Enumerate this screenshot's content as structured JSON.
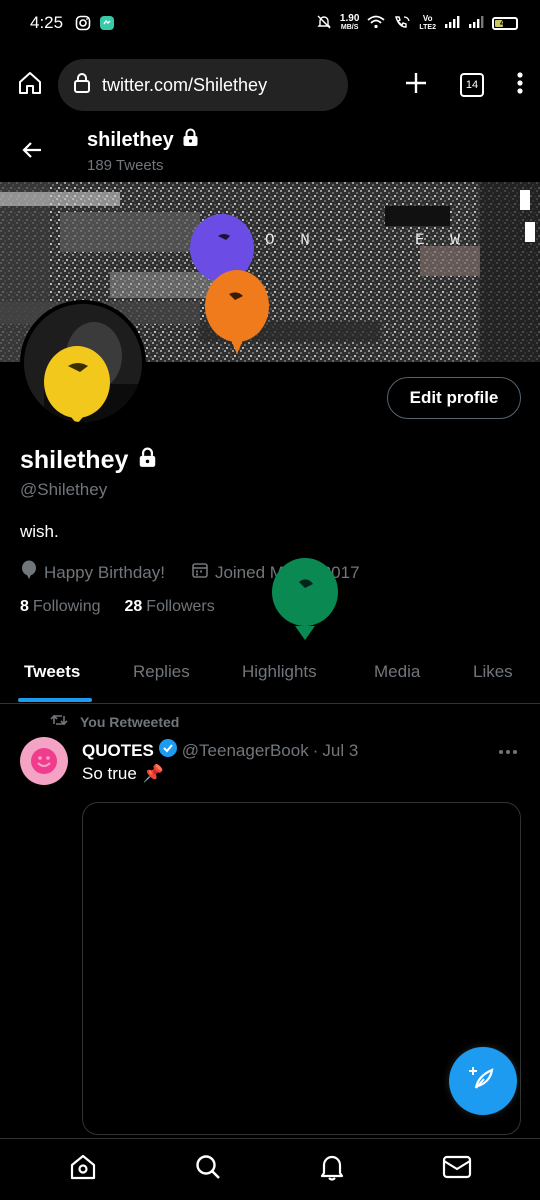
{
  "status_bar": {
    "time": "4:25",
    "net_speed_value": "1.90",
    "net_speed_unit": "MB/S",
    "network_label_top": "Vo",
    "network_label_bottom": "LTE2",
    "battery": "42"
  },
  "browser": {
    "url": "twitter.com/Shilethey",
    "tab_count": "14"
  },
  "header": {
    "name": "shilethey",
    "tweet_count": "189 Tweets"
  },
  "banner": {
    "text_one": "O N -",
    "text_two": "E W"
  },
  "profile": {
    "edit_button": "Edit profile",
    "display_name": "shilethey",
    "handle": "@Shilethey",
    "bio": "wish.",
    "birthday": "Happy Birthday!",
    "joined": "Joined March 2017",
    "following_count": "8",
    "following_label": "Following",
    "followers_count": "28",
    "followers_label": "Followers"
  },
  "tabs": [
    {
      "label": "Tweets",
      "active": true
    },
    {
      "label": "Replies"
    },
    {
      "label": "Highlights"
    },
    {
      "label": "Media"
    },
    {
      "label": "Likes"
    }
  ],
  "tweet": {
    "retweet_label": "You Retweeted",
    "author_name": "QUOTES",
    "author_handle": "@TeenagerBook",
    "separator": "·",
    "date": "Jul 3",
    "text": "So true",
    "emoji": "📌"
  },
  "colors": {
    "accent": "#1d9bf0",
    "balloon_purple": "#6b4de6",
    "balloon_orange": "#f07b1c",
    "balloon_yellow": "#f2c81d",
    "balloon_green": "#0a8a52"
  }
}
